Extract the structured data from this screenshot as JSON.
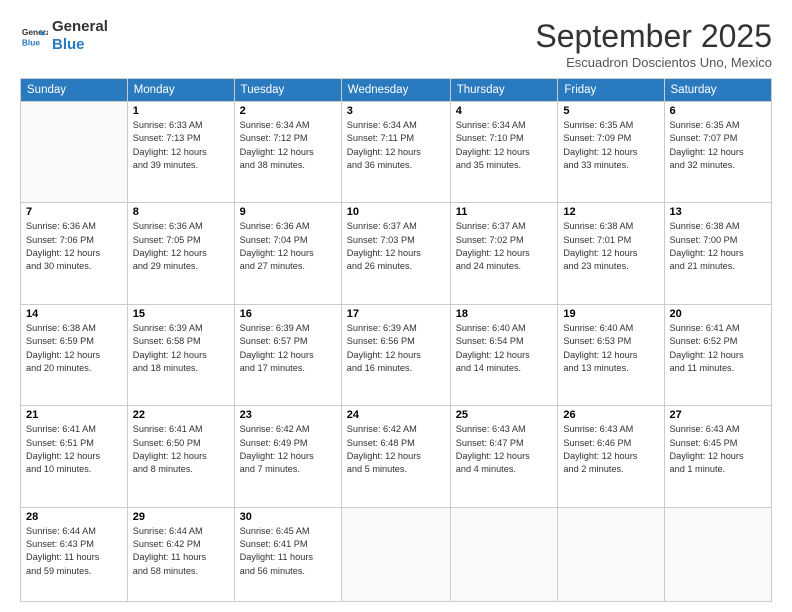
{
  "logo": {
    "line1": "General",
    "line2": "Blue"
  },
  "header": {
    "month": "September 2025",
    "location": "Escuadron Doscientos Uno, Mexico"
  },
  "weekdays": [
    "Sunday",
    "Monday",
    "Tuesday",
    "Wednesday",
    "Thursday",
    "Friday",
    "Saturday"
  ],
  "weeks": [
    [
      {
        "day": "",
        "info": ""
      },
      {
        "day": "1",
        "info": "Sunrise: 6:33 AM\nSunset: 7:13 PM\nDaylight: 12 hours\nand 39 minutes."
      },
      {
        "day": "2",
        "info": "Sunrise: 6:34 AM\nSunset: 7:12 PM\nDaylight: 12 hours\nand 38 minutes."
      },
      {
        "day": "3",
        "info": "Sunrise: 6:34 AM\nSunset: 7:11 PM\nDaylight: 12 hours\nand 36 minutes."
      },
      {
        "day": "4",
        "info": "Sunrise: 6:34 AM\nSunset: 7:10 PM\nDaylight: 12 hours\nand 35 minutes."
      },
      {
        "day": "5",
        "info": "Sunrise: 6:35 AM\nSunset: 7:09 PM\nDaylight: 12 hours\nand 33 minutes."
      },
      {
        "day": "6",
        "info": "Sunrise: 6:35 AM\nSunset: 7:07 PM\nDaylight: 12 hours\nand 32 minutes."
      }
    ],
    [
      {
        "day": "7",
        "info": "Sunrise: 6:36 AM\nSunset: 7:06 PM\nDaylight: 12 hours\nand 30 minutes."
      },
      {
        "day": "8",
        "info": "Sunrise: 6:36 AM\nSunset: 7:05 PM\nDaylight: 12 hours\nand 29 minutes."
      },
      {
        "day": "9",
        "info": "Sunrise: 6:36 AM\nSunset: 7:04 PM\nDaylight: 12 hours\nand 27 minutes."
      },
      {
        "day": "10",
        "info": "Sunrise: 6:37 AM\nSunset: 7:03 PM\nDaylight: 12 hours\nand 26 minutes."
      },
      {
        "day": "11",
        "info": "Sunrise: 6:37 AM\nSunset: 7:02 PM\nDaylight: 12 hours\nand 24 minutes."
      },
      {
        "day": "12",
        "info": "Sunrise: 6:38 AM\nSunset: 7:01 PM\nDaylight: 12 hours\nand 23 minutes."
      },
      {
        "day": "13",
        "info": "Sunrise: 6:38 AM\nSunset: 7:00 PM\nDaylight: 12 hours\nand 21 minutes."
      }
    ],
    [
      {
        "day": "14",
        "info": "Sunrise: 6:38 AM\nSunset: 6:59 PM\nDaylight: 12 hours\nand 20 minutes."
      },
      {
        "day": "15",
        "info": "Sunrise: 6:39 AM\nSunset: 6:58 PM\nDaylight: 12 hours\nand 18 minutes."
      },
      {
        "day": "16",
        "info": "Sunrise: 6:39 AM\nSunset: 6:57 PM\nDaylight: 12 hours\nand 17 minutes."
      },
      {
        "day": "17",
        "info": "Sunrise: 6:39 AM\nSunset: 6:56 PM\nDaylight: 12 hours\nand 16 minutes."
      },
      {
        "day": "18",
        "info": "Sunrise: 6:40 AM\nSunset: 6:54 PM\nDaylight: 12 hours\nand 14 minutes."
      },
      {
        "day": "19",
        "info": "Sunrise: 6:40 AM\nSunset: 6:53 PM\nDaylight: 12 hours\nand 13 minutes."
      },
      {
        "day": "20",
        "info": "Sunrise: 6:41 AM\nSunset: 6:52 PM\nDaylight: 12 hours\nand 11 minutes."
      }
    ],
    [
      {
        "day": "21",
        "info": "Sunrise: 6:41 AM\nSunset: 6:51 PM\nDaylight: 12 hours\nand 10 minutes."
      },
      {
        "day": "22",
        "info": "Sunrise: 6:41 AM\nSunset: 6:50 PM\nDaylight: 12 hours\nand 8 minutes."
      },
      {
        "day": "23",
        "info": "Sunrise: 6:42 AM\nSunset: 6:49 PM\nDaylight: 12 hours\nand 7 minutes."
      },
      {
        "day": "24",
        "info": "Sunrise: 6:42 AM\nSunset: 6:48 PM\nDaylight: 12 hours\nand 5 minutes."
      },
      {
        "day": "25",
        "info": "Sunrise: 6:43 AM\nSunset: 6:47 PM\nDaylight: 12 hours\nand 4 minutes."
      },
      {
        "day": "26",
        "info": "Sunrise: 6:43 AM\nSunset: 6:46 PM\nDaylight: 12 hours\nand 2 minutes."
      },
      {
        "day": "27",
        "info": "Sunrise: 6:43 AM\nSunset: 6:45 PM\nDaylight: 12 hours\nand 1 minute."
      }
    ],
    [
      {
        "day": "28",
        "info": "Sunrise: 6:44 AM\nSunset: 6:43 PM\nDaylight: 11 hours\nand 59 minutes."
      },
      {
        "day": "29",
        "info": "Sunrise: 6:44 AM\nSunset: 6:42 PM\nDaylight: 11 hours\nand 58 minutes."
      },
      {
        "day": "30",
        "info": "Sunrise: 6:45 AM\nSunset: 6:41 PM\nDaylight: 11 hours\nand 56 minutes."
      },
      {
        "day": "",
        "info": ""
      },
      {
        "day": "",
        "info": ""
      },
      {
        "day": "",
        "info": ""
      },
      {
        "day": "",
        "info": ""
      }
    ]
  ]
}
